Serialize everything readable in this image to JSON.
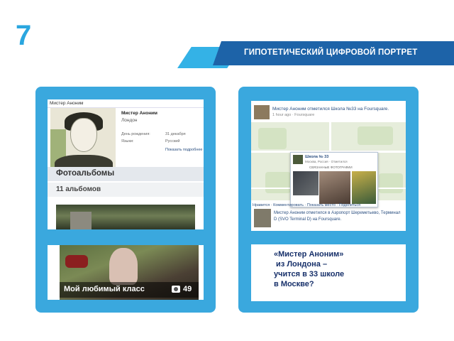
{
  "slide": {
    "number": "7",
    "title": "ГИПОТЕТИЧЕСКИЙ ЦИФРОВОЙ ПОРТРЕТ"
  },
  "profile": {
    "header": "Мистер Аноним",
    "name": "Мистер Аноним",
    "city": "Лондон",
    "rows": [
      {
        "label": "День рождения:",
        "value": "31 декабря"
      },
      {
        "label": "Языки:",
        "value": "Русский"
      },
      {
        "label": "",
        "value": "Показать подробнее"
      }
    ],
    "albums_title": "Фотоальбомы",
    "albums_count": "11 альбомов",
    "album_caption": "Мой любимый класс",
    "album_photo_count": "49"
  },
  "checkins": {
    "first": "Мистер Аноним отметился Школа №33 на Foursquare.",
    "first_sub": "1 hour ago · Foursquare",
    "popup": {
      "name": "Школа № 33",
      "sub": "Москва, Россия · Отметился",
      "related": "СВЯЗАННЫЕ ФОТОГРАФИИ"
    },
    "map_links": "Нравится · Комментировать · Показать место · Поделиться",
    "second": "Мистер Аноним отметился в Аэропорт Шереметьево, Терминал D (SVO Terminal D) на Foursquare."
  },
  "conclusion": {
    "lines": [
      "«Мистер Аноним»",
      " из Лондона –",
      "учится в 33 школе",
      "в Москве?"
    ]
  },
  "colors": {
    "accent": "#2aa6df",
    "ribbon_dark": "#1d63a8",
    "panel": "#3aa8de",
    "conclusion_text": "#17306a"
  }
}
